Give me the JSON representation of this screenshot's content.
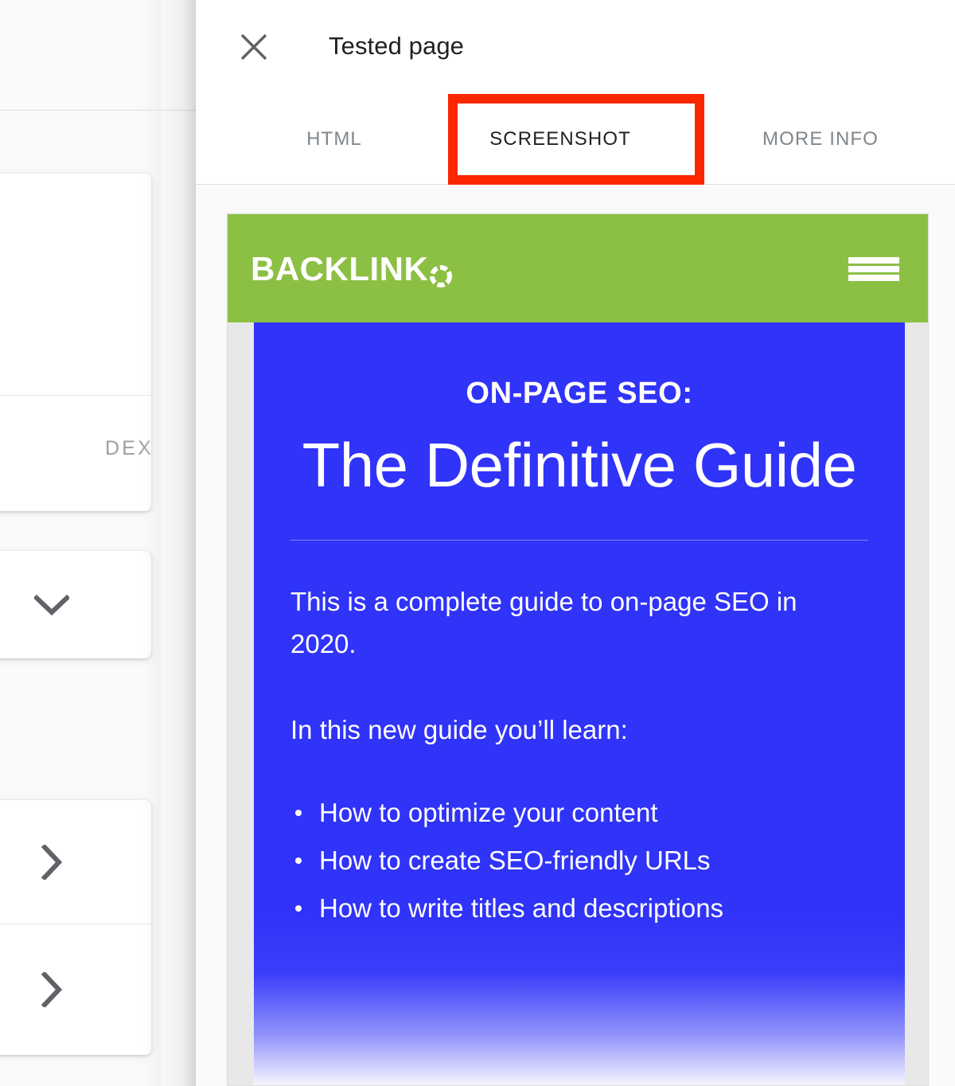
{
  "background_app": {
    "partial_label": "DEXING",
    "cards": [
      {
        "rows": [
          {
            "icon": ""
          },
          {
            "icon": "",
            "label": "DEXING"
          }
        ]
      },
      {
        "rows": [
          {
            "icon": "chevron-down-icon"
          }
        ]
      },
      {
        "rows": [
          {
            "icon": "chevron-right-icon"
          },
          {
            "icon": "chevron-right-icon"
          }
        ]
      }
    ]
  },
  "panel": {
    "close_icon": "close-icon",
    "title": "Tested page",
    "tabs": [
      {
        "label": "HTML",
        "active": false
      },
      {
        "label": "SCREENSHOT",
        "active": true
      },
      {
        "label": "MORE INFO",
        "active": false
      }
    ],
    "annotation": {
      "shape": "rectangle",
      "color": "#FA2600",
      "targets_tab": "SCREENSHOT"
    }
  },
  "screenshot": {
    "site_header": {
      "background_color": "#8CC044",
      "logo_text": "BACKLINK",
      "logo_mark": "dotted-circle-o-icon",
      "menu_icon": "hamburger-menu-icon"
    },
    "page": {
      "background_color": "#3033F8",
      "kicker": "ON-PAGE SEO:",
      "title": "The Definitive Guide",
      "paragraphs": [
        "This is a complete guide to on-page SEO in 2020.",
        "In this new guide you’ll learn:"
      ],
      "bullets": [
        "How to optimize your content",
        "How to create SEO-friendly URLs",
        "How to write titles and descriptions"
      ]
    }
  }
}
